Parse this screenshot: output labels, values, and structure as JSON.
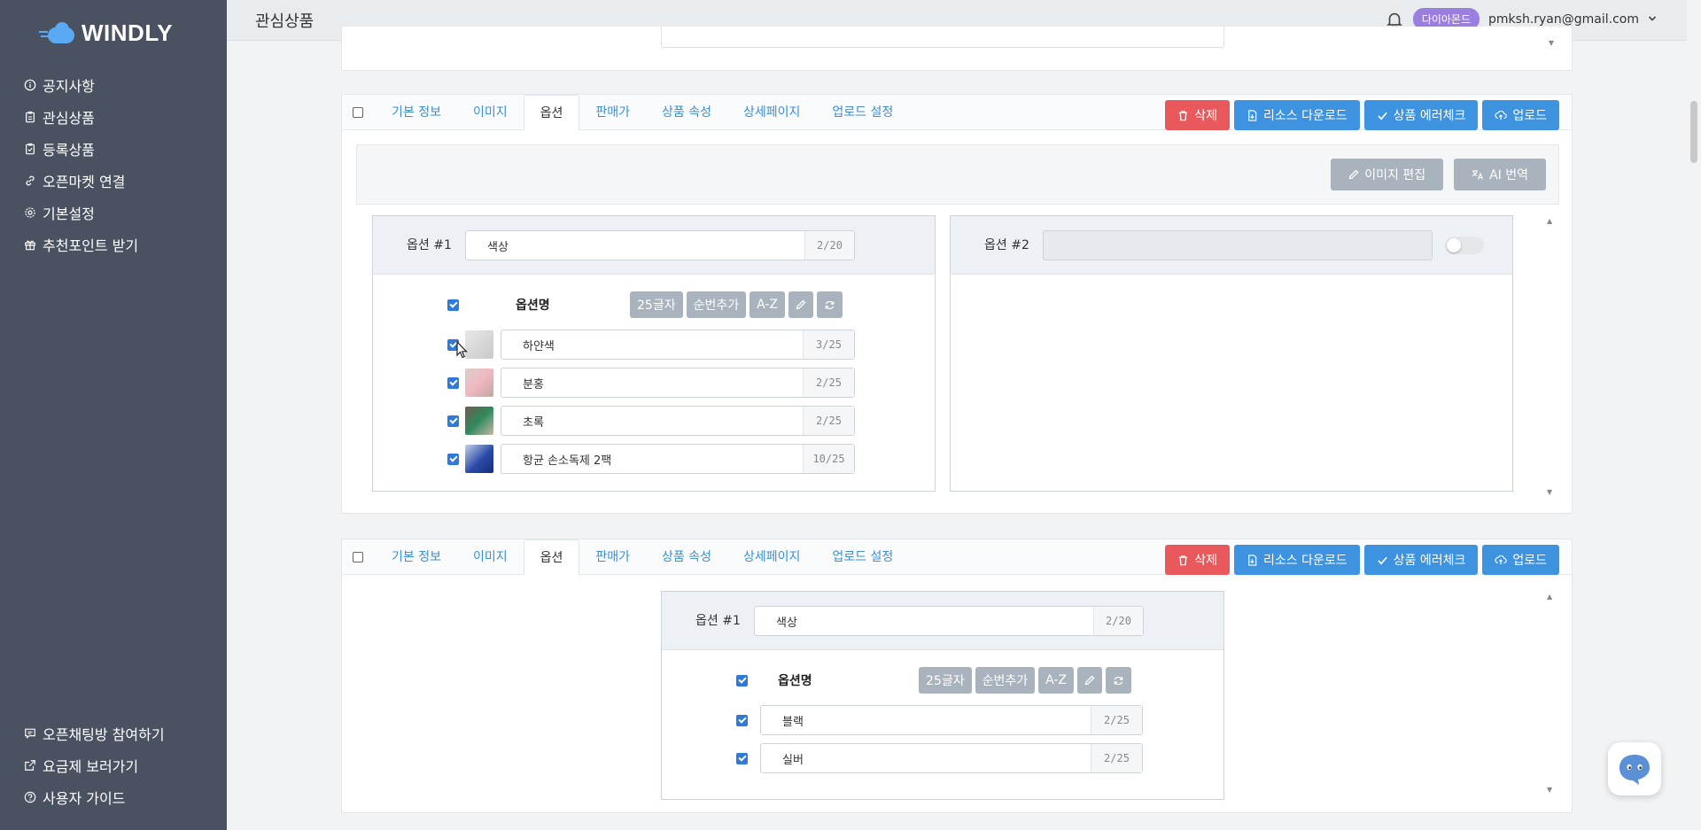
{
  "app": {
    "logo_text": "WINDLY"
  },
  "sidebar": {
    "items": [
      {
        "label": "공지사항",
        "icon": "info-icon"
      },
      {
        "label": "관심상품",
        "icon": "clipboard-icon"
      },
      {
        "label": "등록상품",
        "icon": "clipboard-check-icon"
      },
      {
        "label": "오픈마켓 연결",
        "icon": "link-icon"
      },
      {
        "label": "기본설정",
        "icon": "gear-icon"
      },
      {
        "label": "추천포인트 받기",
        "icon": "gift-icon"
      }
    ],
    "bottom_items": [
      {
        "label": "오픈채팅방 참여하기",
        "icon": "chat-icon"
      },
      {
        "label": "요금제 보러가기",
        "icon": "external-link-icon"
      },
      {
        "label": "사용자 가이드",
        "icon": "help-icon"
      }
    ]
  },
  "header": {
    "title": "관심상품",
    "badge": "다이아몬드",
    "email": "pmksh.ryan@gmail.com"
  },
  "tabs": [
    "기본 정보",
    "이미지",
    "옵션",
    "판매가",
    "상품 속성",
    "상세페이지",
    "업로드 설정"
  ],
  "actions": {
    "delete": "삭제",
    "resource_download": "리소스 다운로드",
    "error_check": "상품 에러체크",
    "upload": "업로드"
  },
  "tools": {
    "image_edit": "이미지 편집",
    "ai_translate": "AI 번역"
  },
  "option_tools": {
    "col_name": "옵션명",
    "chars25": "25글자",
    "add_seq": "순번추가",
    "az": "A-Z"
  },
  "card1": {
    "option1": {
      "label": "옵션 #1",
      "name": "색상",
      "count": "2/20",
      "rows": [
        {
          "name": "하얀색",
          "count": "3/25"
        },
        {
          "name": "분홍",
          "count": "2/25"
        },
        {
          "name": "초록",
          "count": "2/25"
        },
        {
          "name": "항균 손소독제 2팩",
          "count": "10/25"
        }
      ]
    },
    "option2": {
      "label": "옵션 #2"
    }
  },
  "card2": {
    "option1": {
      "label": "옵션 #1",
      "name": "색상",
      "count": "2/20",
      "rows": [
        {
          "name": "블랙",
          "count": "2/25"
        },
        {
          "name": "실버",
          "count": "2/25"
        }
      ]
    }
  },
  "colors": {
    "sidebar_bg": "#4a5262",
    "accent_blue": "#3d93e0",
    "danger_red": "#e9595c",
    "badge_purple": "#9b7fe0"
  }
}
